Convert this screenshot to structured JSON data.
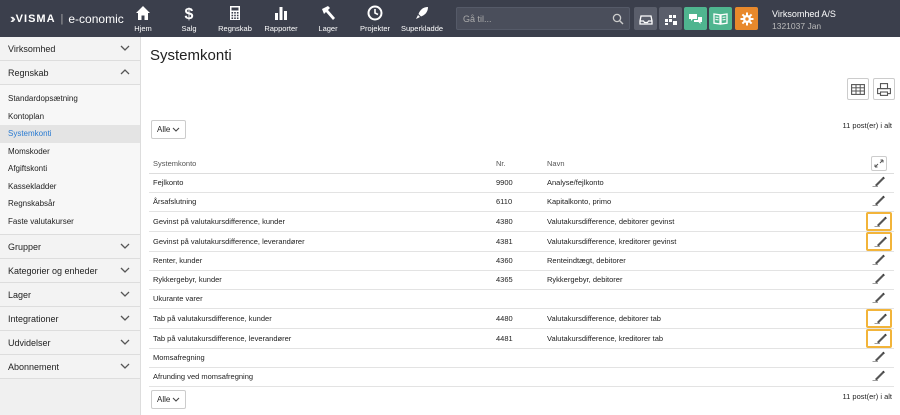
{
  "topbar": {
    "logo_brand": "VISMA",
    "logo_sep": "|",
    "logo_product": "e-conomic",
    "nav": [
      {
        "label": "Hjem",
        "icon": "home-icon"
      },
      {
        "label": "Salg",
        "icon": "dollar-icon"
      },
      {
        "label": "Regnskab",
        "icon": "calculator-icon"
      },
      {
        "label": "Rapporter",
        "icon": "bar-chart-icon"
      },
      {
        "label": "Lager",
        "icon": "hammer-icon"
      },
      {
        "label": "Projekter",
        "icon": "clock-icon"
      },
      {
        "label": "Superkladde",
        "icon": "rocket-icon"
      }
    ],
    "search_placeholder": "Gå til...",
    "company_name": "Virksomhed A/S",
    "company_sub": "1321037 Jan",
    "colors": {
      "bar": "#3b3f4c",
      "green": "#4fb58f",
      "orange": "#e8892c"
    }
  },
  "sidebar": {
    "groups_top": [
      "Virksomhed"
    ],
    "open_group": "Regnskab",
    "subitems": [
      "Standardopsætning",
      "Kontoplan",
      "Systemkonti",
      "Momskoder",
      "Afgiftskonti",
      "Kassekladder",
      "Regnskabsår",
      "Faste valutakurser"
    ],
    "active_subitem": "Systemkonti",
    "groups_bottom": [
      "Grupper",
      "Kategorier og enheder",
      "Lager",
      "Integrationer",
      "Udvidelser",
      "Abonnement"
    ]
  },
  "main": {
    "title": "Systemkonti",
    "filter_value": "Alle",
    "post_count": "11 post(er) i alt",
    "columns": {
      "name": "Systemkonto",
      "nr": "Nr.",
      "navn": "Navn"
    },
    "rows": [
      {
        "name": "Fejlkonto",
        "nr": "9900",
        "navn": "Analyse/fejlkonto"
      },
      {
        "name": "Årsafslutning",
        "nr": "6110",
        "navn": "Kapitalkonto, primo"
      },
      {
        "name": "Gevinst på valutakursdifference, kunder",
        "nr": "4380",
        "navn": "Valutakursdifference, debitorer gevinst"
      },
      {
        "name": "Gevinst på valutakursdifference, leverandører",
        "nr": "4381",
        "navn": "Valutakursdifference, kreditorer gevinst"
      },
      {
        "name": "Renter, kunder",
        "nr": "4360",
        "navn": "Renteindtægt, debitorer"
      },
      {
        "name": "Rykkergebyr, kunder",
        "nr": "4365",
        "navn": "Rykkergebyr, debitorer"
      },
      {
        "name": "Ukurante varer",
        "nr": "",
        "navn": ""
      },
      {
        "name": "Tab på valutakursdifference, kunder",
        "nr": "4480",
        "navn": "Valutakursdifference, debitorer tab"
      },
      {
        "name": "Tab på valutakursdifference, leverandører",
        "nr": "4481",
        "navn": "Valutakursdifference, kreditorer tab"
      },
      {
        "name": "Momsafregning",
        "nr": "",
        "navn": ""
      },
      {
        "name": "Afrunding ved momsafregning",
        "nr": "",
        "navn": ""
      }
    ],
    "highlight_color": "#f2b43a"
  }
}
